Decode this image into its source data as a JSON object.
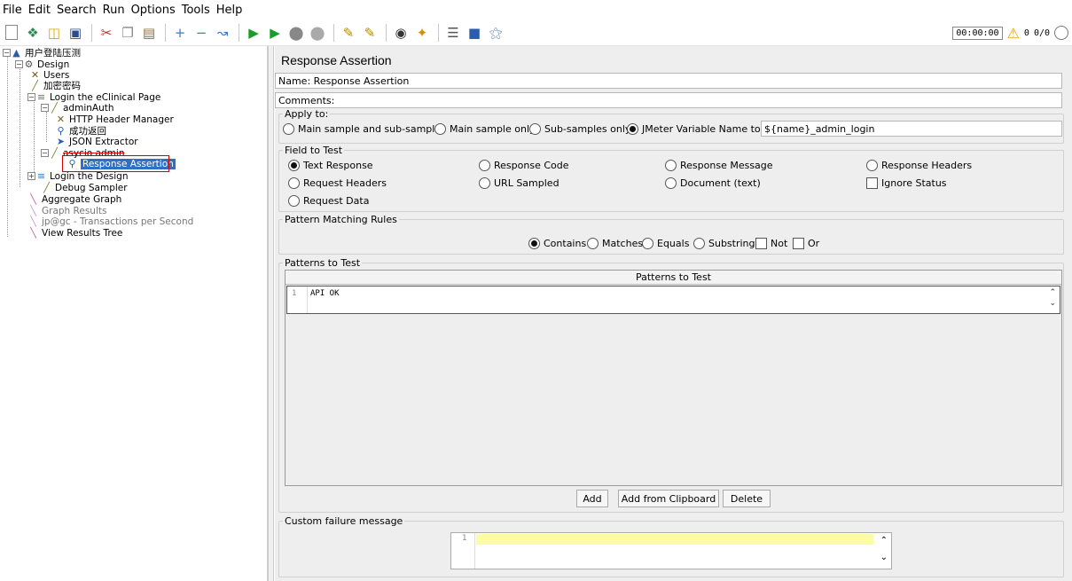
{
  "menu": [
    "File",
    "Edit",
    "Search",
    "Run",
    "Options",
    "Tools",
    "Help"
  ],
  "status": {
    "timer": "00:00:00",
    "warnings": "0",
    "threads": "0/0"
  },
  "tree": {
    "root": "用户登陆压测",
    "items": [
      "Design",
      "Users",
      "加密密码",
      "Login the eClinical Page",
      "adminAuth",
      "HTTP Header Manager",
      "成功返回",
      "JSON Extractor",
      "asycio admin",
      "Response Assertion",
      "Login the Design",
      "Debug Sampler",
      "Aggregate Graph",
      "Graph Results",
      "jp@gc - Transactions per Second",
      "View Results Tree"
    ]
  },
  "panel": {
    "title": "Response Assertion",
    "name_label": "Name:",
    "name_value": "Response Assertion",
    "comments_label": "Comments:",
    "apply_to": {
      "legend": "Apply to:",
      "options": [
        "Main sample and sub-samples",
        "Main sample only",
        "Sub-samples only",
        "JMeter Variable Name to use"
      ],
      "selected": "JMeter Variable Name to use",
      "variable_value": "${name}_admin_login"
    },
    "field_to_test": {
      "legend": "Field to Test",
      "options": [
        "Text Response",
        "Response Code",
        "Response Message",
        "Response Headers",
        "Request Headers",
        "URL Sampled",
        "Document (text)",
        "Request Data"
      ],
      "checkbox": "Ignore Status",
      "selected": "Text Response"
    },
    "pattern_rules": {
      "legend": "Pattern Matching Rules",
      "options": [
        "Contains",
        "Matches",
        "Equals",
        "Substring"
      ],
      "checkboxes": [
        "Not",
        "Or"
      ],
      "selected": "Contains"
    },
    "patterns": {
      "legend": "Patterns to Test",
      "column": "Patterns to Test",
      "line_number": "1",
      "rows": [
        "API OK"
      ]
    },
    "buttons": {
      "add": "Add",
      "add_clipboard": "Add from Clipboard",
      "delete": "Delete"
    },
    "failure": {
      "legend": "Custom failure message",
      "line_number": "1"
    }
  }
}
